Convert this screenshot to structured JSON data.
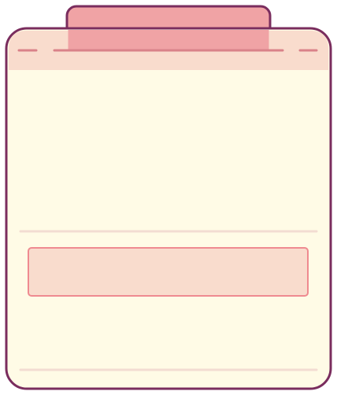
{
  "illustration": {
    "icon": "clipboard-illustration",
    "colors": {
      "outline": "#7a2d5e",
      "body_fill": "#fffbe6",
      "header_fill": "#f9dccd",
      "tab_fill": "#f0a3a5",
      "tab_line": "#d98289",
      "divider": "#f3dcd2",
      "field_fill": "#f9dccd",
      "field_border": "#ef8a90"
    }
  }
}
